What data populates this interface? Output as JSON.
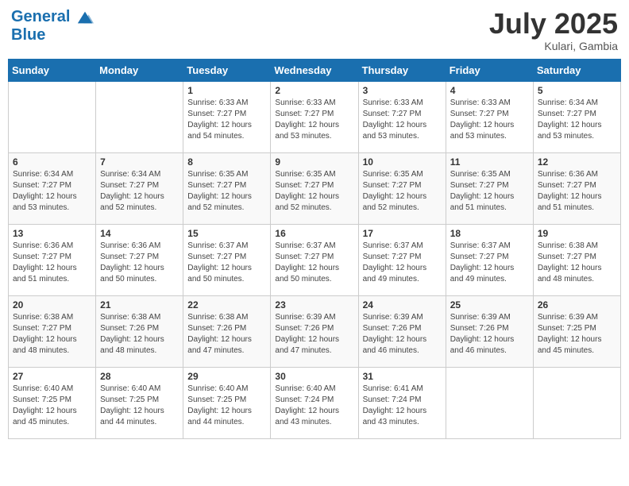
{
  "header": {
    "logo_line1": "General",
    "logo_line2": "Blue",
    "month": "July 2025",
    "location": "Kulari, Gambia"
  },
  "weekdays": [
    "Sunday",
    "Monday",
    "Tuesday",
    "Wednesday",
    "Thursday",
    "Friday",
    "Saturday"
  ],
  "weeks": [
    [
      {
        "day": "",
        "info": ""
      },
      {
        "day": "",
        "info": ""
      },
      {
        "day": "1",
        "info": "Sunrise: 6:33 AM\nSunset: 7:27 PM\nDaylight: 12 hours and 54 minutes."
      },
      {
        "day": "2",
        "info": "Sunrise: 6:33 AM\nSunset: 7:27 PM\nDaylight: 12 hours and 53 minutes."
      },
      {
        "day": "3",
        "info": "Sunrise: 6:33 AM\nSunset: 7:27 PM\nDaylight: 12 hours and 53 minutes."
      },
      {
        "day": "4",
        "info": "Sunrise: 6:33 AM\nSunset: 7:27 PM\nDaylight: 12 hours and 53 minutes."
      },
      {
        "day": "5",
        "info": "Sunrise: 6:34 AM\nSunset: 7:27 PM\nDaylight: 12 hours and 53 minutes."
      }
    ],
    [
      {
        "day": "6",
        "info": "Sunrise: 6:34 AM\nSunset: 7:27 PM\nDaylight: 12 hours and 53 minutes."
      },
      {
        "day": "7",
        "info": "Sunrise: 6:34 AM\nSunset: 7:27 PM\nDaylight: 12 hours and 52 minutes."
      },
      {
        "day": "8",
        "info": "Sunrise: 6:35 AM\nSunset: 7:27 PM\nDaylight: 12 hours and 52 minutes."
      },
      {
        "day": "9",
        "info": "Sunrise: 6:35 AM\nSunset: 7:27 PM\nDaylight: 12 hours and 52 minutes."
      },
      {
        "day": "10",
        "info": "Sunrise: 6:35 AM\nSunset: 7:27 PM\nDaylight: 12 hours and 52 minutes."
      },
      {
        "day": "11",
        "info": "Sunrise: 6:35 AM\nSunset: 7:27 PM\nDaylight: 12 hours and 51 minutes."
      },
      {
        "day": "12",
        "info": "Sunrise: 6:36 AM\nSunset: 7:27 PM\nDaylight: 12 hours and 51 minutes."
      }
    ],
    [
      {
        "day": "13",
        "info": "Sunrise: 6:36 AM\nSunset: 7:27 PM\nDaylight: 12 hours and 51 minutes."
      },
      {
        "day": "14",
        "info": "Sunrise: 6:36 AM\nSunset: 7:27 PM\nDaylight: 12 hours and 50 minutes."
      },
      {
        "day": "15",
        "info": "Sunrise: 6:37 AM\nSunset: 7:27 PM\nDaylight: 12 hours and 50 minutes."
      },
      {
        "day": "16",
        "info": "Sunrise: 6:37 AM\nSunset: 7:27 PM\nDaylight: 12 hours and 50 minutes."
      },
      {
        "day": "17",
        "info": "Sunrise: 6:37 AM\nSunset: 7:27 PM\nDaylight: 12 hours and 49 minutes."
      },
      {
        "day": "18",
        "info": "Sunrise: 6:37 AM\nSunset: 7:27 PM\nDaylight: 12 hours and 49 minutes."
      },
      {
        "day": "19",
        "info": "Sunrise: 6:38 AM\nSunset: 7:27 PM\nDaylight: 12 hours and 48 minutes."
      }
    ],
    [
      {
        "day": "20",
        "info": "Sunrise: 6:38 AM\nSunset: 7:27 PM\nDaylight: 12 hours and 48 minutes."
      },
      {
        "day": "21",
        "info": "Sunrise: 6:38 AM\nSunset: 7:26 PM\nDaylight: 12 hours and 48 minutes."
      },
      {
        "day": "22",
        "info": "Sunrise: 6:38 AM\nSunset: 7:26 PM\nDaylight: 12 hours and 47 minutes."
      },
      {
        "day": "23",
        "info": "Sunrise: 6:39 AM\nSunset: 7:26 PM\nDaylight: 12 hours and 47 minutes."
      },
      {
        "day": "24",
        "info": "Sunrise: 6:39 AM\nSunset: 7:26 PM\nDaylight: 12 hours and 46 minutes."
      },
      {
        "day": "25",
        "info": "Sunrise: 6:39 AM\nSunset: 7:26 PM\nDaylight: 12 hours and 46 minutes."
      },
      {
        "day": "26",
        "info": "Sunrise: 6:39 AM\nSunset: 7:25 PM\nDaylight: 12 hours and 45 minutes."
      }
    ],
    [
      {
        "day": "27",
        "info": "Sunrise: 6:40 AM\nSunset: 7:25 PM\nDaylight: 12 hours and 45 minutes."
      },
      {
        "day": "28",
        "info": "Sunrise: 6:40 AM\nSunset: 7:25 PM\nDaylight: 12 hours and 44 minutes."
      },
      {
        "day": "29",
        "info": "Sunrise: 6:40 AM\nSunset: 7:25 PM\nDaylight: 12 hours and 44 minutes."
      },
      {
        "day": "30",
        "info": "Sunrise: 6:40 AM\nSunset: 7:24 PM\nDaylight: 12 hours and 43 minutes."
      },
      {
        "day": "31",
        "info": "Sunrise: 6:41 AM\nSunset: 7:24 PM\nDaylight: 12 hours and 43 minutes."
      },
      {
        "day": "",
        "info": ""
      },
      {
        "day": "",
        "info": ""
      }
    ]
  ]
}
